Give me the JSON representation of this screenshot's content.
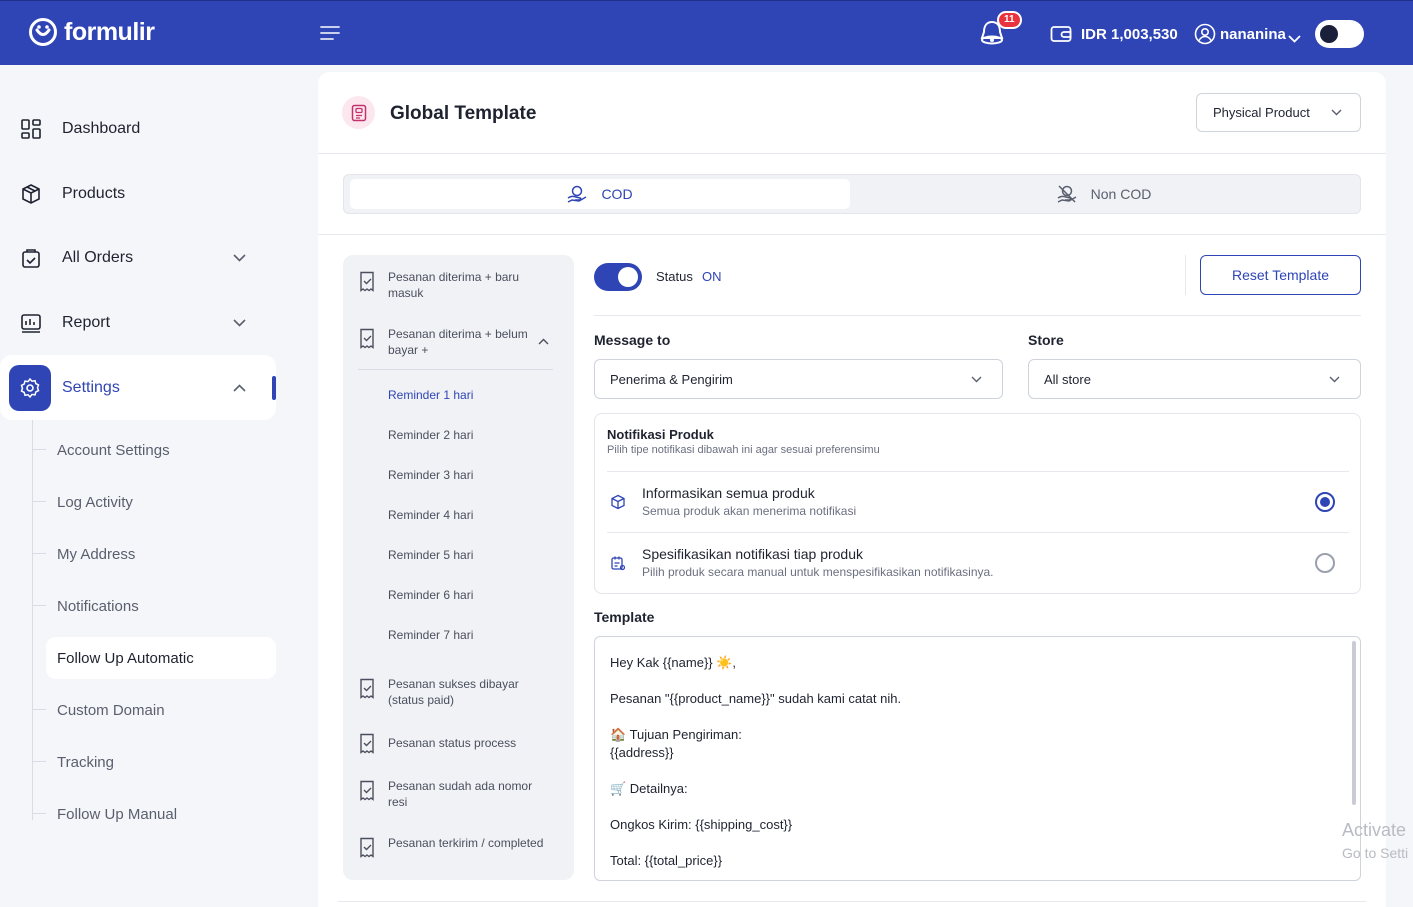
{
  "header": {
    "brand": "formulir",
    "notification_count": "11",
    "balance": "IDR 1,003,530",
    "username": "nananina"
  },
  "sidebar": {
    "items": [
      {
        "label": "Dashboard",
        "icon": "dashboard-icon"
      },
      {
        "label": "Products",
        "icon": "box-icon"
      },
      {
        "label": "All Orders",
        "icon": "bag-icon"
      },
      {
        "label": "Report",
        "icon": "report-icon"
      },
      {
        "label": "Settings",
        "icon": "gear-icon"
      }
    ],
    "settings_sub": [
      "Account Settings",
      "Log Activity",
      "My Address",
      "Notifications",
      "Follow Up Automatic",
      "Custom Domain",
      "Tracking",
      "Follow Up Manual"
    ],
    "active_sub": "Follow Up Automatic"
  },
  "page": {
    "title": "Global Template",
    "product_type": "Physical Product",
    "tabs": [
      "COD",
      "Non COD"
    ],
    "active_tab": "COD"
  },
  "steps": {
    "items": [
      "Pesanan diterima + baru masuk",
      "Pesanan diterima + belum bayar +",
      "Pesanan sukses dibayar (status paid)",
      "Pesanan status process",
      "Pesanan sudah ada nomor resi",
      "Pesanan terkirim / completed"
    ],
    "reminders": [
      "Reminder 1 hari",
      "Reminder 2 hari",
      "Reminder 3 hari",
      "Reminder 4 hari",
      "Reminder 5 hari",
      "Reminder 6 hari",
      "Reminder 7 hari"
    ],
    "active_reminder": "Reminder 1 hari"
  },
  "form": {
    "status_label": "Status",
    "status_value": "ON",
    "reset_label": "Reset Template",
    "message_to_label": "Message to",
    "message_to_value": "Penerima & Pengirim",
    "store_label": "Store",
    "store_value": "All store",
    "notif_title": "Notifikasi Produk",
    "notif_sub": "Pilih tipe notifikasi dibawah ini agar sesuai preferensimu",
    "options": [
      {
        "title": "Informasikan semua produk",
        "sub": "Semua produk akan menerima notifikasi",
        "checked": true
      },
      {
        "title": "Spesifikasikan notifikasi tiap produk",
        "sub": "Pilih produk secara manual untuk menspesifikasikan notifikasinya.",
        "checked": false
      }
    ],
    "template_label": "Template",
    "template_lines": [
      "Hey Kak {{name}} ☀️,",
      "Pesanan \"{{product_name}}\" sudah kami catat nih.",
      "🏠 Tujuan Pengiriman:",
      "{{address}}",
      "🛒 Detailnya:",
      "Ongkos Kirim: {{shipping_cost}}",
      "Total: {{total_price}}"
    ]
  },
  "watermark": {
    "line1": "Activate",
    "line2": "Go to Setti"
  },
  "colors": {
    "primary": "#2f45b5",
    "background": "#f5f6fa",
    "badge": "#e8343f"
  }
}
